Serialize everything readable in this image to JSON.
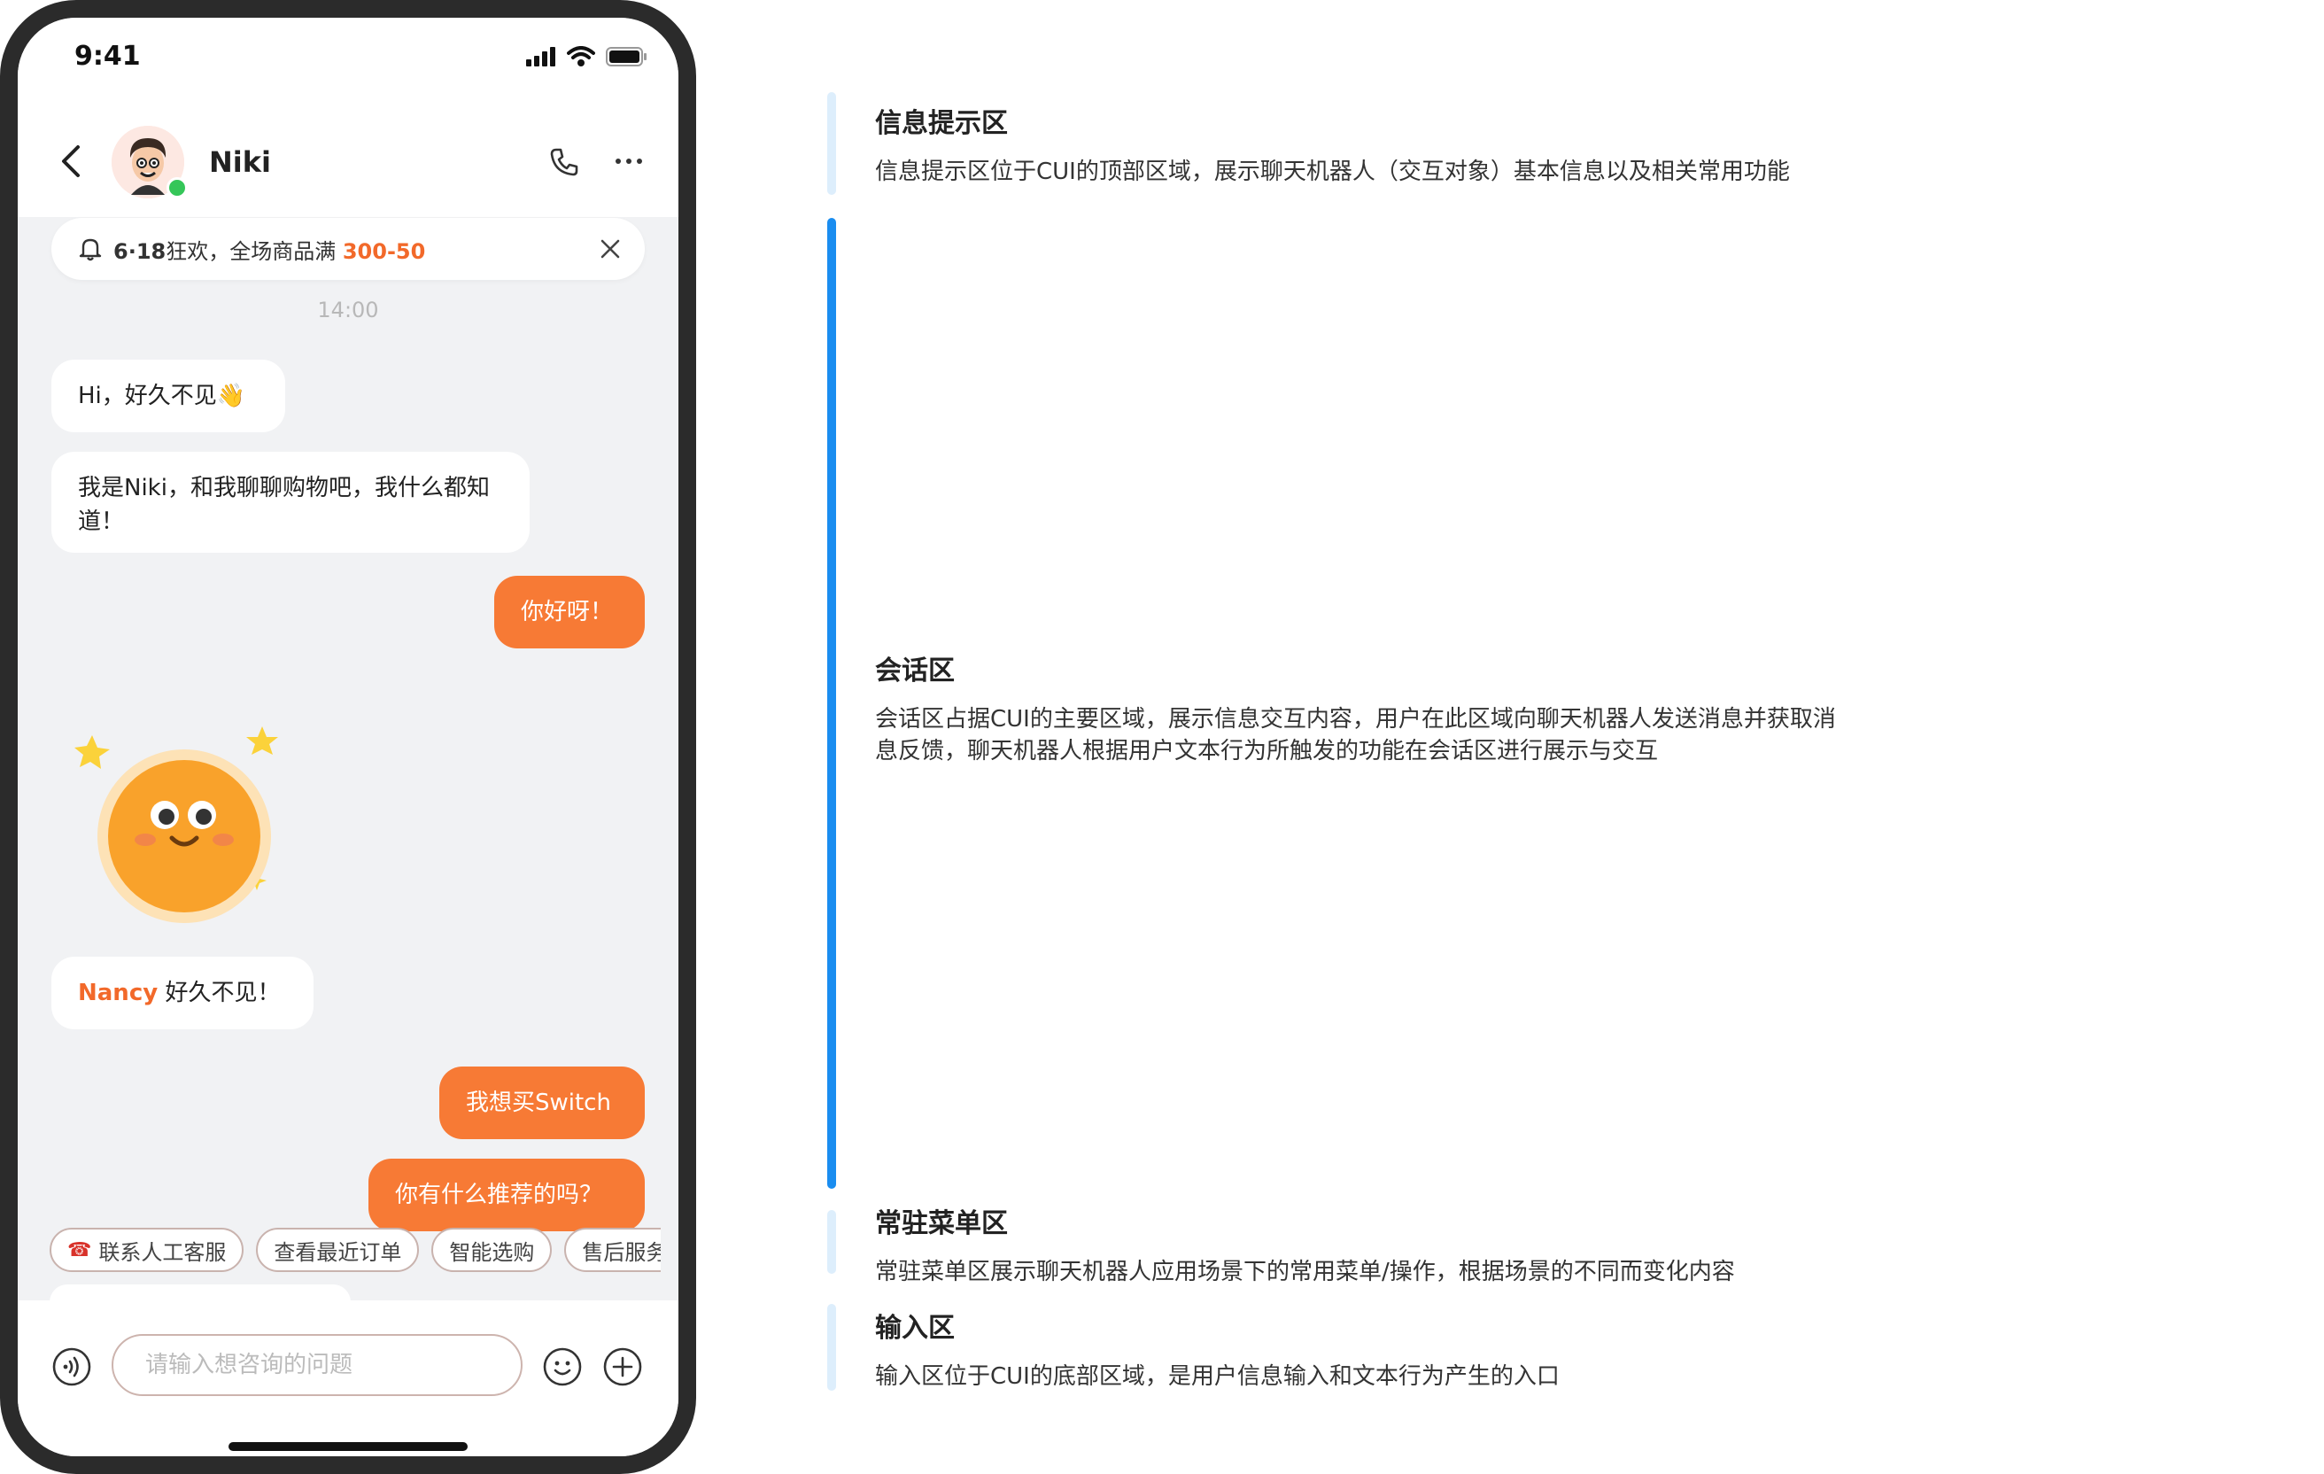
{
  "status": {
    "time": "9:41"
  },
  "header": {
    "name": "Niki"
  },
  "notice": {
    "date": "6·18",
    "text": "狂欢，全场商品满 ",
    "accent": "300-50"
  },
  "chat": {
    "timestamp": "14:00",
    "messages": [
      {
        "side": "left",
        "text": "Hi，好久不见👋"
      },
      {
        "side": "left",
        "text": "我是Niki，和我聊聊购物吧，我什么都知道！"
      },
      {
        "side": "right",
        "text": "你好呀！"
      },
      {
        "side": "left",
        "name": "Nancy",
        "text": " 好久不见！"
      },
      {
        "side": "right",
        "text": "我想买Switch"
      },
      {
        "side": "right",
        "text": "你有什么推荐的吗？"
      }
    ]
  },
  "quick_menu": [
    {
      "label": "联系人工客服",
      "icon": "telephone-icon"
    },
    {
      "label": "查看最近订单"
    },
    {
      "label": "智能选购"
    },
    {
      "label": "售后服务"
    }
  ],
  "input": {
    "placeholder": "请输入想咨询的问题"
  },
  "colors": {
    "accent": "#f77a35",
    "highlight_bar": "#1a8df0",
    "bar": "#ddeefc"
  },
  "annotations": [
    {
      "title": "信息提示区",
      "desc": "信息提示区位于CUI的顶部区域，展示聊天机器人（交互对象）基本信息以及相关常用功能"
    },
    {
      "title": "会话区",
      "desc": "会话区占据CUI的主要区域，展示信息交互内容，用户在此区域向聊天机器人发送消息并获取消息反馈，聊天机器人根据用户文本行为所触发的功能在会话区进行展示与交互"
    },
    {
      "title": "常驻菜单区",
      "desc": "常驻菜单区展示聊天机器人应用场景下的常用菜单/操作，根据场景的不同而变化内容"
    },
    {
      "title": "输入区",
      "desc": "输入区位于CUI的底部区域，是用户信息输入和文本行为产生的入口"
    }
  ]
}
